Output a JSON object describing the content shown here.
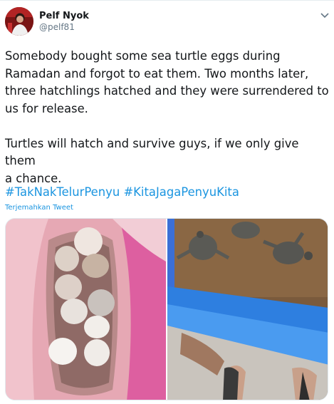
{
  "author": {
    "name": "Pelf Nyok",
    "handle": "@pelf81"
  },
  "tweet": {
    "text": "Somebody bought some sea turtle eggs during\nRamadan and forgot to eat them. Two months later,\nthree hatchlings hatched and they were surrendered to\nus for release.\n\nTurtles will hatch and survive guys, if we only give them\na chance.",
    "hashtags": [
      "#TakNakTelurPenyu",
      "#KitaJagaPenyuKita"
    ],
    "translate_label": "Terjemahkan Tweet"
  },
  "icons": {
    "menu": "chevron-down-icon"
  },
  "colors": {
    "link": "#1b95e0",
    "text": "#14171a",
    "secondary": "#657786"
  }
}
